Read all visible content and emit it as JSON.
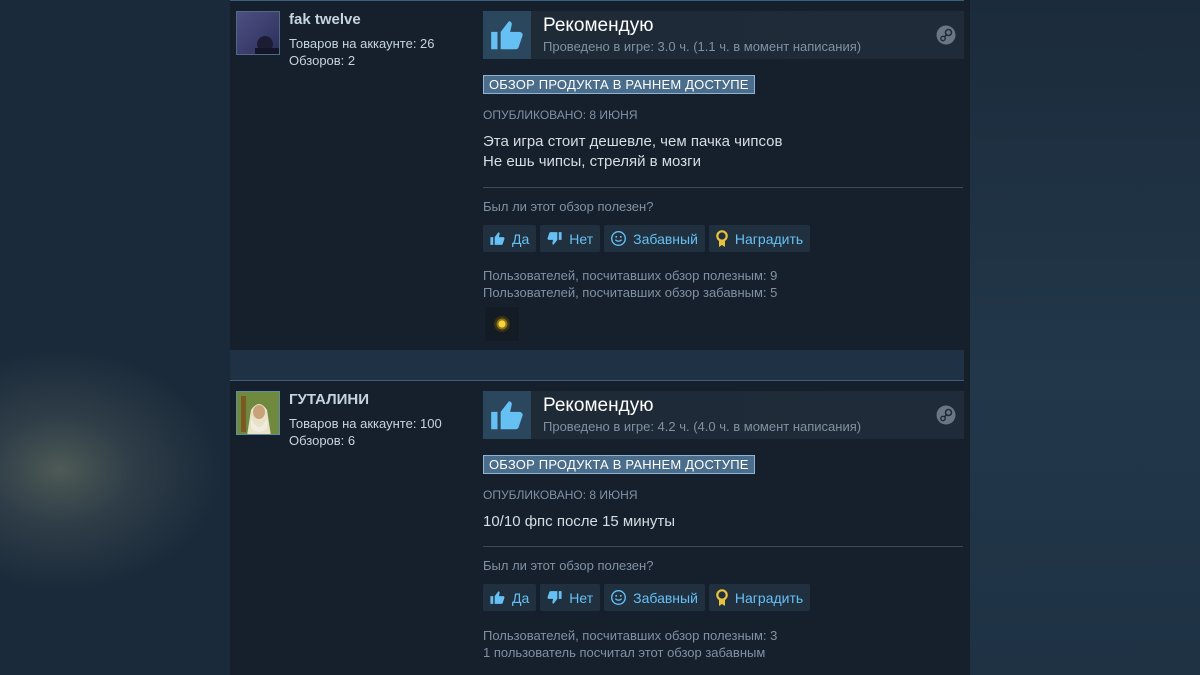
{
  "reviews": [
    {
      "user": {
        "name": "fak twelve",
        "products": "Товаров на аккаунте: 26",
        "reviews": "Обзоров: 2"
      },
      "verdict": "Рекомендую",
      "hours": "Проведено в игре: 3.0 ч. (1.1 ч. в момент написания)",
      "badge": "ОБЗОР ПРОДУКТА В РАННЕМ ДОСТУПЕ",
      "posted": "ОПУБЛИКОВАНО: 8 ИЮНЯ",
      "text_lines": [
        "Эта игра стоит дешевле, чем пачка чипсов",
        "Не ешь чипсы, стреляй в мозги"
      ],
      "helpful_question": "Был ли этот обзор полезен?",
      "buttons": {
        "yes": "Да",
        "no": "Нет",
        "funny": "Забавный",
        "award": "Наградить"
      },
      "stats": [
        "Пользователей, посчитавших обзор полезным: 9",
        "Пользователей, посчитавших обзор забавным: 5"
      ]
    },
    {
      "user": {
        "name": "ГУТАЛИНИ",
        "products": "Товаров на аккаунте: 100",
        "reviews": "Обзоров: 6"
      },
      "verdict": "Рекомендую",
      "hours": "Проведено в игре: 4.2 ч. (4.0 ч. в момент написания)",
      "badge": "ОБЗОР ПРОДУКТА В РАННЕМ ДОСТУПЕ",
      "posted": "ОПУБЛИКОВАНО: 8 ИЮНЯ",
      "text_lines": [
        "10/10 фпс после 15 минуты"
      ],
      "helpful_question": "Был ли этот обзор полезен?",
      "buttons": {
        "yes": "Да",
        "no": "Нет",
        "funny": "Забавный",
        "award": "Наградить"
      },
      "stats": [
        "Пользователей, посчитавших обзор полезным: 3",
        "1 пользователь посчитал этот обзор забавным"
      ]
    }
  ],
  "colors": {
    "accent": "#66c0f4",
    "badge_bg": "#4a6d8c",
    "panel": "#16202d",
    "muted": "#8091a2"
  },
  "icons": [
    "thumbs-up-icon",
    "thumbs-down-icon",
    "smiley-icon",
    "award-ribbon-icon",
    "steam-icon",
    "award-coin-icon"
  ]
}
